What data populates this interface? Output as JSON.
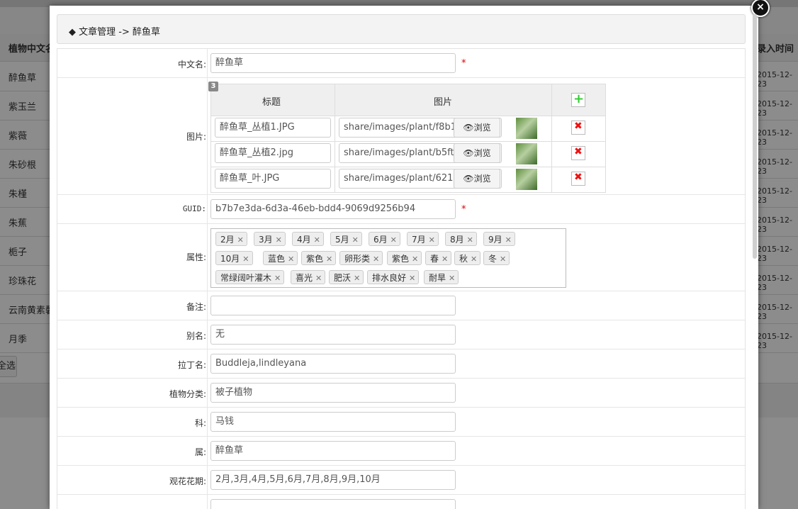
{
  "background": {
    "header": {
      "name_col": "植物中文名",
      "time_col": "录入时间"
    },
    "rows": [
      {
        "name": "醉鱼草",
        "date": "2015-12-23"
      },
      {
        "name": "紫玉兰",
        "date": "2015-12-23"
      },
      {
        "name": "紫薇",
        "date": "2015-12-23"
      },
      {
        "name": "朱砂根",
        "date": "2015-12-23"
      },
      {
        "name": "朱槿",
        "date": "2015-12-23"
      },
      {
        "name": "朱蕉",
        "date": "2015-12-23"
      },
      {
        "name": "栀子",
        "date": "2015-12-23"
      },
      {
        "name": "珍珠花",
        "date": "2015-12-23"
      },
      {
        "name": "云南黄素馨",
        "date": "2015-12-23"
      },
      {
        "name": "月季",
        "date": "2015-12-23"
      }
    ],
    "select_button": "全选"
  },
  "modal": {
    "close_icon": "×",
    "breadcrumb": "◆ 文章管理 -> 醉鱼草",
    "fields": {
      "cn_name": {
        "label": "中文名:",
        "value": "醉鱼草",
        "required": "*"
      },
      "images": {
        "label": "图片:",
        "count_badge": "3",
        "col_title": "标题",
        "col_image": "图片",
        "add_icon": "+",
        "rows": [
          {
            "title": "醉鱼草_丛植1.JPG",
            "path": "share/images/plant/f8b1",
            "browse": "👁浏览",
            "delete": "✖"
          },
          {
            "title": "醉鱼草_丛植2.jpg",
            "path": "share/images/plant/b5ft",
            "browse": "👁浏览",
            "delete": "✖"
          },
          {
            "title": "醉鱼草_叶.JPG",
            "path": "share/images/plant/621",
            "browse": "👁浏览",
            "delete": "✖"
          }
        ]
      },
      "guid": {
        "label": "GUID:",
        "value": "b7b7e3da-6d3a-46eb-bdd4-9069d9256b94",
        "required": "*"
      },
      "attributes": {
        "label": "属性:",
        "tags": [
          "2月",
          "3月",
          "4月",
          "5月",
          "6月",
          "7月",
          "8月",
          "9月",
          "10月",
          "蓝色",
          "紫色",
          "卵形类",
          "紫色",
          "春",
          "秋",
          "冬",
          "常绿阔叶灌木",
          "喜光",
          "肥沃",
          "排水良好",
          "耐旱"
        ],
        "remove_icon": "✕"
      },
      "remark": {
        "label": "备注:",
        "value": ""
      },
      "alias": {
        "label": "别名:",
        "value": "无"
      },
      "latin": {
        "label": "拉丁名:",
        "value": "Buddleja,lindleyana"
      },
      "category": {
        "label": "植物分类:",
        "value": "被子植物"
      },
      "family": {
        "label": "科:",
        "value": "马钱"
      },
      "genus": {
        "label": "属:",
        "value": "醉鱼草"
      },
      "flowering": {
        "label": "观花花期:",
        "value": "2月,3月,4月,5月,6月,7月,8月,9月,10月"
      }
    }
  }
}
